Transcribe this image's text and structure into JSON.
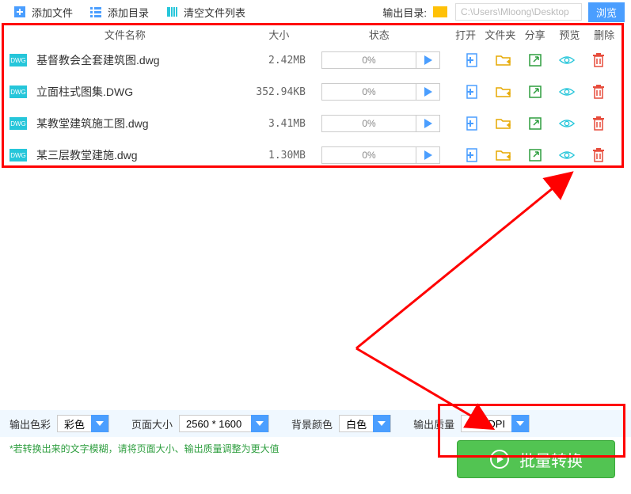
{
  "toolbar": {
    "add_file": "添加文件",
    "add_dir": "添加目录",
    "clear_list": "清空文件列表",
    "output_dir_label": "输出目录:",
    "output_path": "C:\\Users\\Mloong\\Desktop",
    "browse": "浏览"
  },
  "headers": {
    "name": "文件名称",
    "size": "大小",
    "status": "状态",
    "open": "打开",
    "folder": "文件夹",
    "share": "分享",
    "preview": "预览",
    "delete": "删除"
  },
  "files": [
    {
      "badge": "DWG",
      "name": "基督教会全套建筑图.dwg",
      "size": "2.42MB",
      "progress": "0%"
    },
    {
      "badge": "DWG",
      "name": "立面柱式图集.DWG",
      "size": "352.94KB",
      "progress": "0%"
    },
    {
      "badge": "DWG",
      "name": "某教堂建筑施工图.dwg",
      "size": "3.41MB",
      "progress": "0%"
    },
    {
      "badge": "DWG",
      "name": "某三层教堂建施.dwg",
      "size": "1.30MB",
      "progress": "0%"
    }
  ],
  "settings": {
    "color_label": "输出色彩",
    "color_value": "彩色",
    "page_label": "页面大小",
    "page_value": "2560 * 1600",
    "bg_label": "背景颜色",
    "bg_value": "白色",
    "quality_label": "输出质量",
    "quality_value": "600 DPI"
  },
  "hint": "*若转换出来的文字模糊，请将页面大小、输出质量调整为更大值",
  "convert_btn": "批量转换"
}
